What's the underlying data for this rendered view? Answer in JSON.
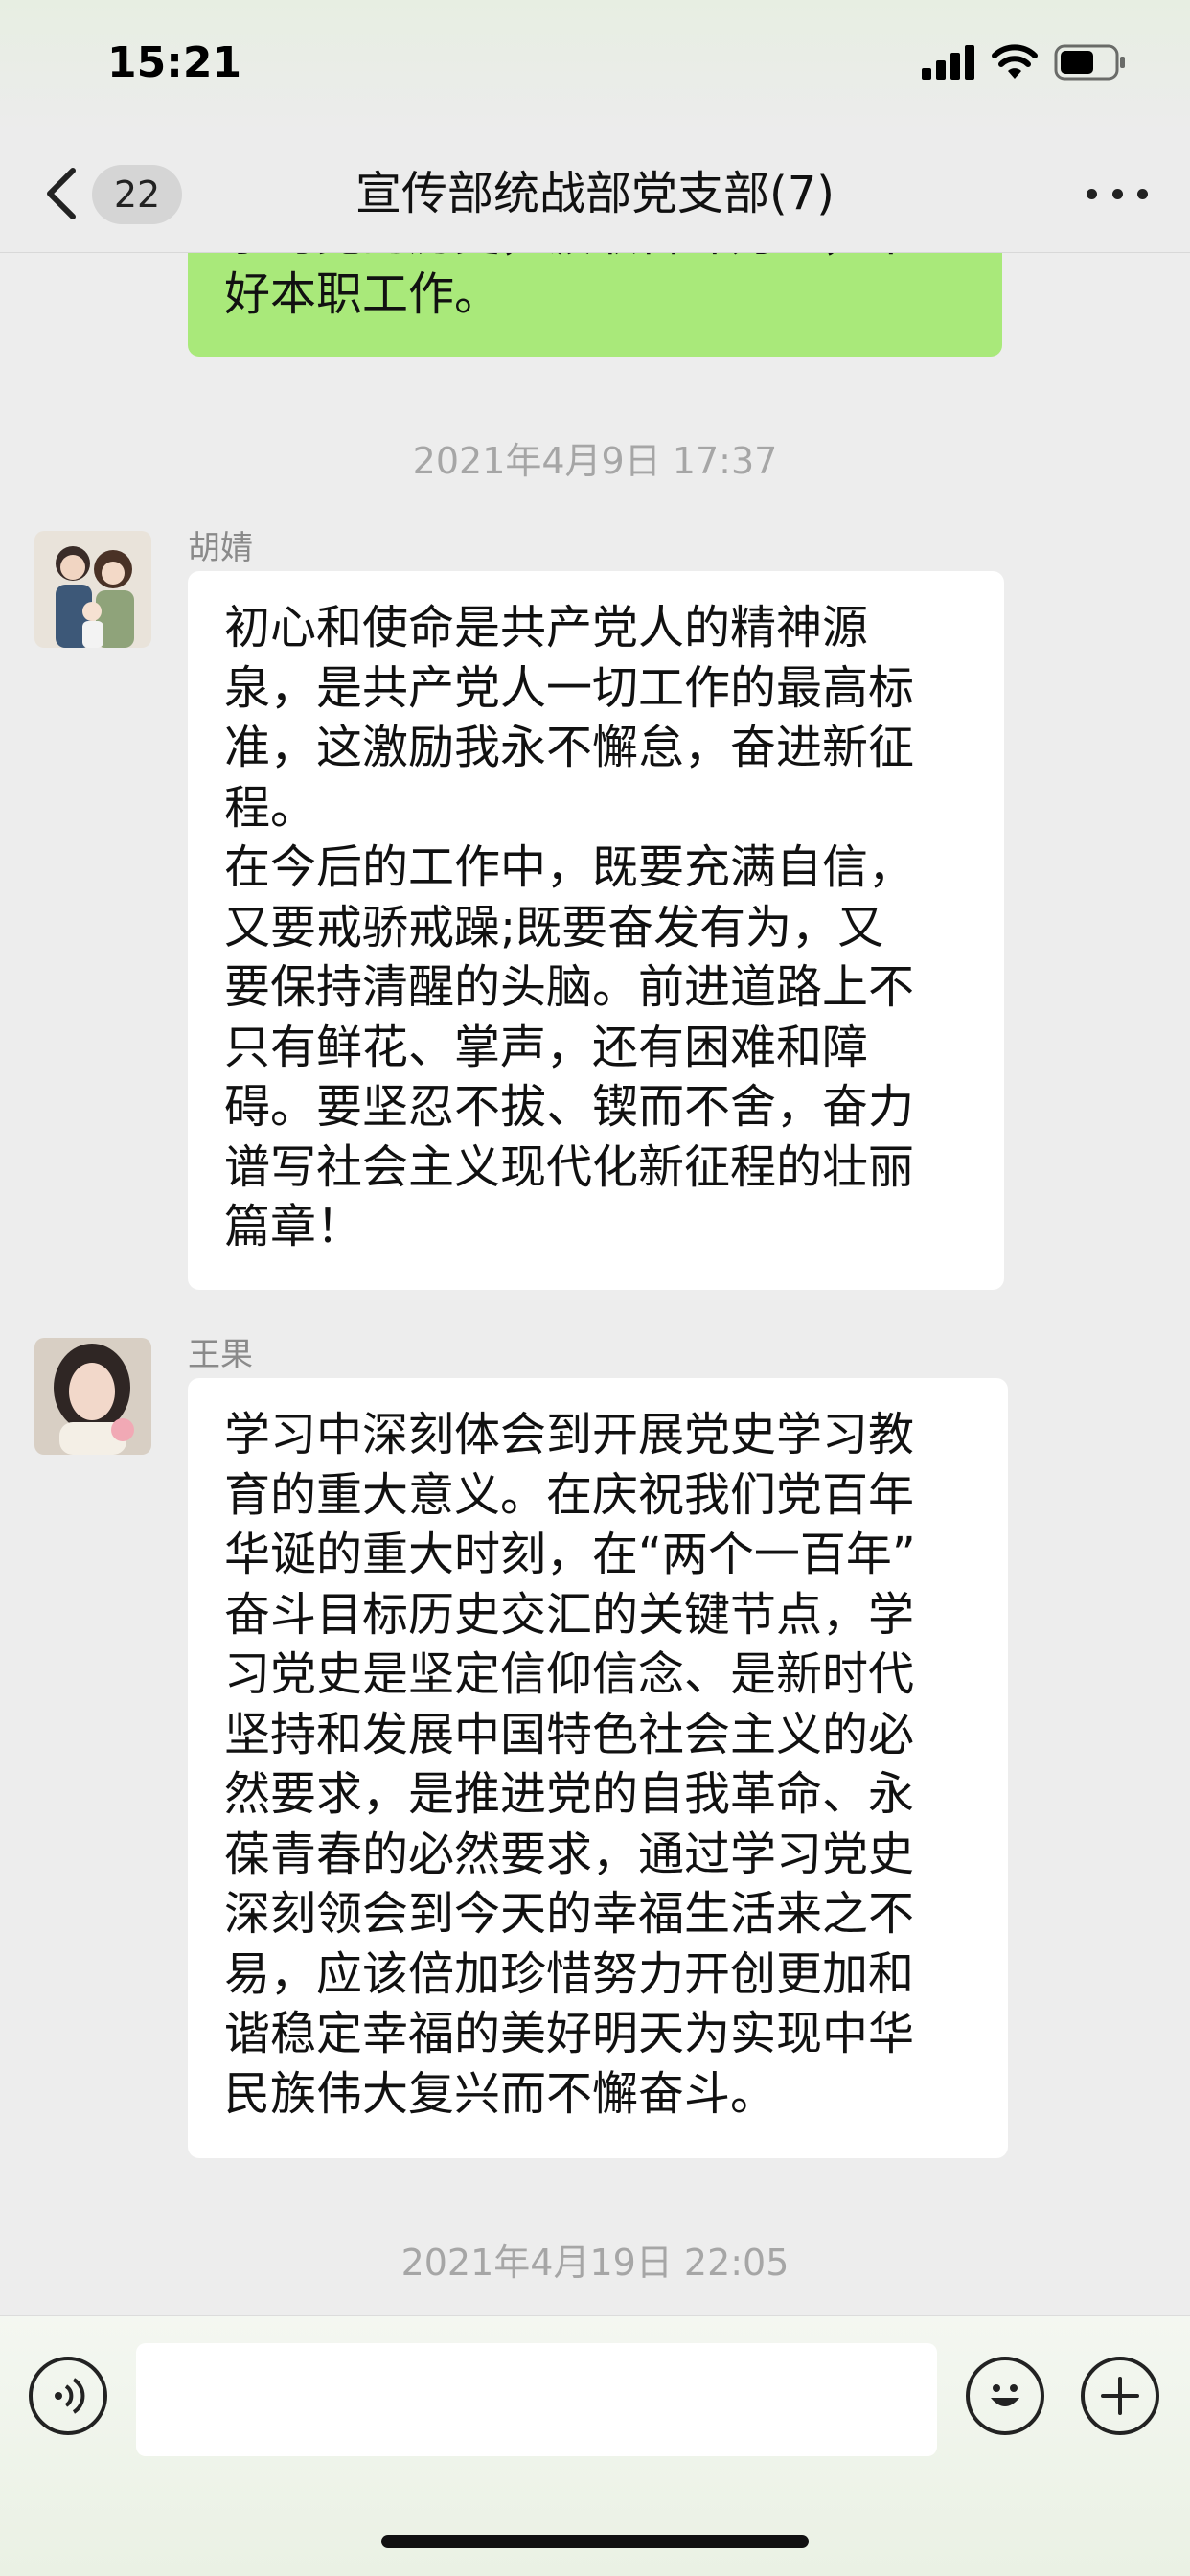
{
  "status_bar": {
    "time": "15:21"
  },
  "header": {
    "unread_count": "22",
    "title": "宣传部统战部党支部(7)"
  },
  "messages": [
    {
      "type": "outgoing",
      "text": "学习党的历史，汲取奋斗力量，干\n好本职工作。"
    },
    {
      "type": "timestamp",
      "text": "2021年4月9日 17:37"
    },
    {
      "type": "incoming",
      "sender": "胡婧",
      "text": "初心和使命是共产党人的精神源\n泉，是共产党人一切工作的最高标\n准，这激励我永不懈怠，奋进新征\n程。\n在今后的工作中，既要充满自信，\n又要戒骄戒躁;既要奋发有为，又\n要保持清醒的头脑。前进道路上不\n只有鲜花、掌声，还有困难和障\n碍。要坚忍不拔、锲而不舍，奋力\n谱写社会主义现代化新征程的壮丽\n篇章！"
    },
    {
      "type": "incoming",
      "sender": "王果",
      "text": "学习中深刻体会到开展党史学习教\n育的重大意义。在庆祝我们党百年\n华诞的重大时刻，在“两个一百年”\n奋斗目标历史交汇的关键节点，学\n习党史是坚定信仰信念、是新时代\n坚持和发展中国特色社会主义的必\n然要求，是推进党的自我革命、永\n葆青春的必然要求，通过学习党史\n深刻领会到今天的幸福生活来之不\n易，应该倍加珍惜努力开创更加和\n谐稳定幸福的美好明天为实现中华\n民族伟大复兴而不懈奋斗。"
    },
    {
      "type": "timestamp",
      "text": "2021年4月19日 22:05"
    }
  ],
  "input": {
    "value": ""
  },
  "icons": [
    "back-icon",
    "more-icon",
    "voice-icon",
    "emoji-icon",
    "plus-icon",
    "signal-icon",
    "wifi-icon",
    "battery-icon"
  ]
}
